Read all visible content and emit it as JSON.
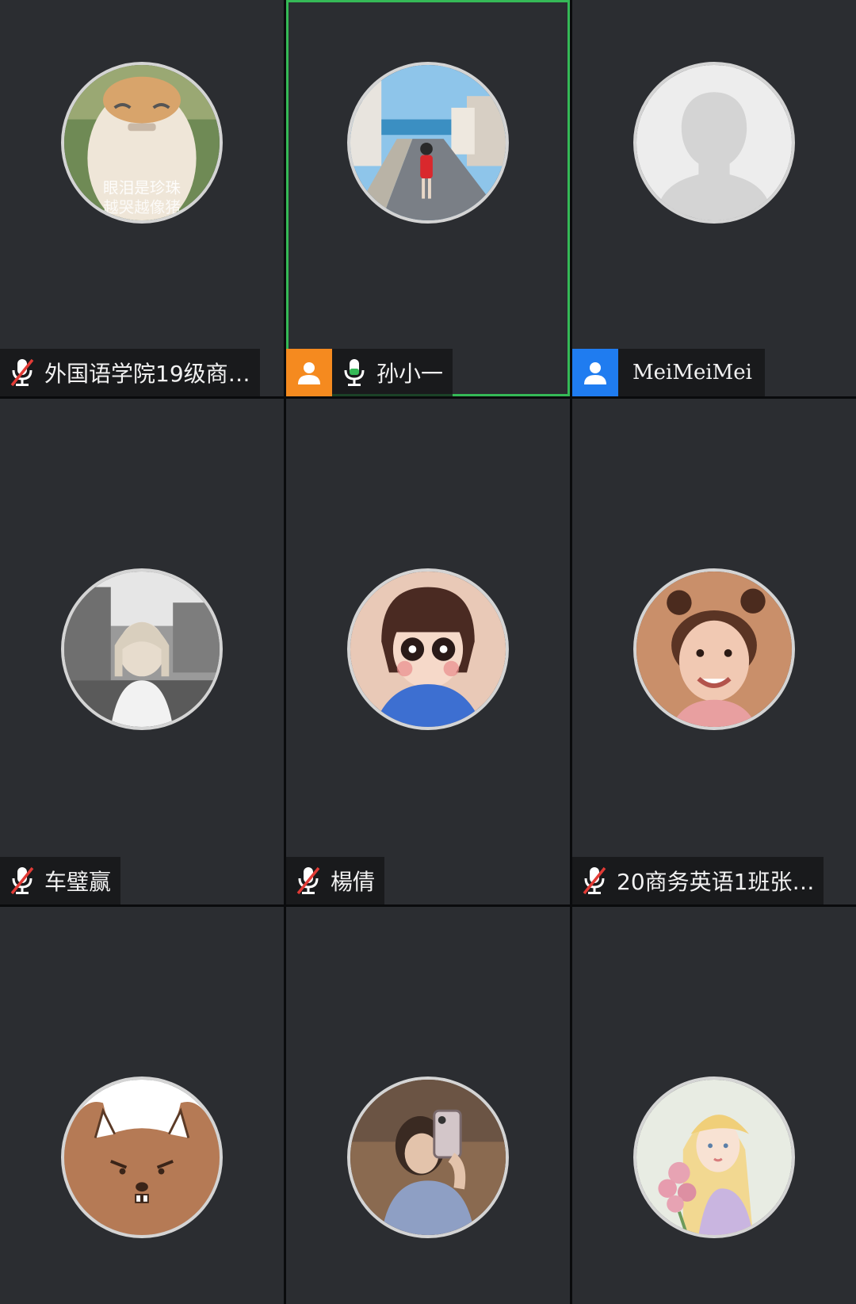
{
  "colors": {
    "tile_bg": "#2b2d31",
    "active_outline": "#35b957",
    "badge_orange": "#f58a1f",
    "badge_blue": "#1f7cf0",
    "mic_active": "#35b957",
    "mic_muted_slash": "#e23b36"
  },
  "participants": [
    {
      "name": "外国语学院19级商…",
      "mic": "muted",
      "avatar": "cat-crying-avatar"
    },
    {
      "name": "孙小一",
      "mic": "active",
      "badge": "orange",
      "active_speaker": true,
      "avatar": "girl-on-street-avatar"
    },
    {
      "name": "MeiMeiMei",
      "mic": "none",
      "badge": "blue",
      "avatar": "default-silhouette-avatar"
    },
    {
      "name": "车璧赢",
      "mic": "muted",
      "avatar": "woman-bw-photo-avatar"
    },
    {
      "name": "楊倩",
      "mic": "muted",
      "avatar": "child-panda-eyes-avatar"
    },
    {
      "name": "20商务英语1班张…",
      "mic": "muted",
      "avatar": "smiling-girl-avatar"
    },
    {
      "name": "",
      "avatar": "cartoon-squirrel-avatar"
    },
    {
      "name": "",
      "avatar": "mirror-selfie-avatar"
    },
    {
      "name": "",
      "avatar": "illustrated-girl-flowers-avatar"
    }
  ]
}
